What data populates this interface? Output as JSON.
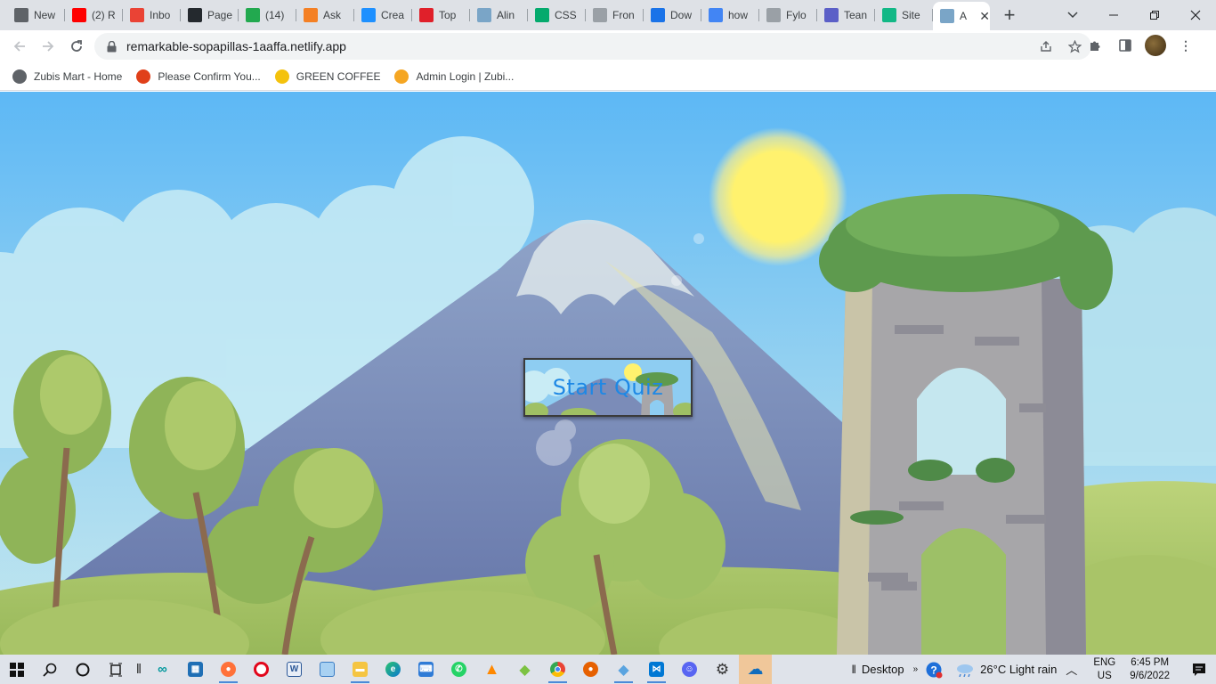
{
  "browser": {
    "tabs": [
      {
        "title": "New",
        "icon": "chrome-icon",
        "color": "#5f6368"
      },
      {
        "title": "(2) R",
        "icon": "youtube-icon",
        "color": "#ff0000"
      },
      {
        "title": "Inbo",
        "icon": "gmail-icon",
        "color": "#ea4335"
      },
      {
        "title": "Page",
        "icon": "github-icon",
        "color": "#24292e"
      },
      {
        "title": "(14)",
        "icon": "badge-14-icon",
        "color": "#22a94f"
      },
      {
        "title": "Ask",
        "icon": "stackoverflow-icon",
        "color": "#f48024"
      },
      {
        "title": "Crea",
        "icon": "cn-icon",
        "color": "#1e90ff"
      },
      {
        "title": "Top",
        "icon": "toptal-icon",
        "color": "#e0202a"
      },
      {
        "title": "Alin",
        "icon": "landscape-icon",
        "color": "#7aa5c7"
      },
      {
        "title": "CSS",
        "icon": "w3schools-icon",
        "color": "#04aa6d"
      },
      {
        "title": "Fron",
        "icon": "page-icon",
        "color": "#9aa0a6"
      },
      {
        "title": "Dow",
        "icon": "download-icon",
        "color": "#1a73e8"
      },
      {
        "title": "how",
        "icon": "google-icon",
        "color": "#4285f4"
      },
      {
        "title": "Fylo",
        "icon": "fylo-icon",
        "color": "#9aa0a6"
      },
      {
        "title": "Tean",
        "icon": "teams-icon",
        "color": "#5b5fc7"
      },
      {
        "title": "Site",
        "icon": "diamond-icon",
        "color": "#12b886"
      },
      {
        "title": "A",
        "icon": "landscape-icon",
        "color": "#7aa5c7",
        "active": true
      }
    ],
    "url": "remarkable-sopapillas-1aaffa.netlify.app",
    "bookmarks": [
      {
        "label": "Zubis Mart - Home",
        "icon": "globe-icon",
        "color": "#5f6368"
      },
      {
        "label": "Please Confirm You...",
        "icon": "shopping-bag-icon",
        "color": "#e0401a"
      },
      {
        "label": "GREEN COFFEE",
        "icon": "smiley-icon",
        "color": "#f4c20d"
      },
      {
        "label": "Admin Login | Zubi...",
        "icon": "zubis-icon",
        "color": "#f5a623"
      }
    ]
  },
  "page": {
    "start_button_label": "Start Quiz"
  },
  "taskbar": {
    "desktop_label": "Desktop",
    "weather": "26°C  Light rain",
    "lang_top": "ENG",
    "lang_bottom": "US",
    "time": "6:45 PM",
    "date": "9/6/2022"
  }
}
